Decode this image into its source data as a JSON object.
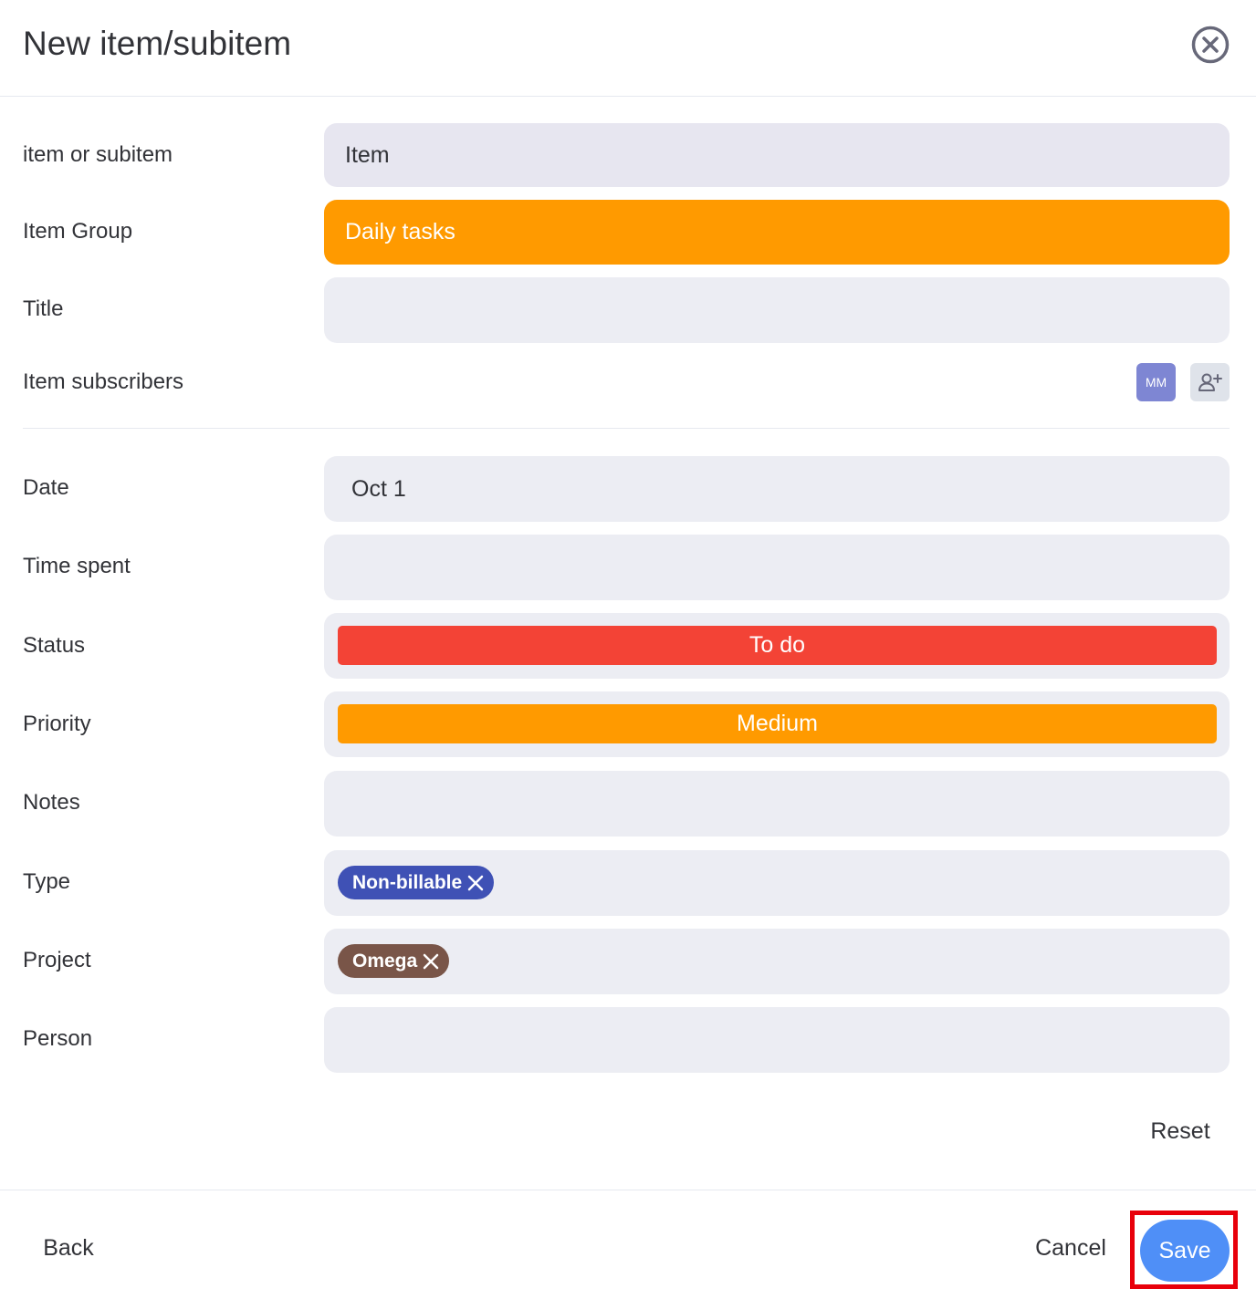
{
  "dialog": {
    "title": "New item/subitem"
  },
  "fields": {
    "kind": {
      "label": "item or subitem",
      "value": "Item"
    },
    "group": {
      "label": "Item Group",
      "value": "Daily tasks",
      "color": "#ff9a00"
    },
    "title": {
      "label": "Title",
      "value": ""
    },
    "subscribers": {
      "label": "Item subscribers",
      "avatar_initials": "MM",
      "avatar_color": "#7e86d3"
    },
    "date": {
      "label": "Date",
      "value": "Oct 1"
    },
    "time_spent": {
      "label": "Time spent",
      "value": ""
    },
    "status": {
      "label": "Status",
      "value": "To do",
      "color": "#f34336"
    },
    "priority": {
      "label": "Priority",
      "value": "Medium",
      "color": "#ff9a00"
    },
    "notes": {
      "label": "Notes",
      "value": ""
    },
    "type": {
      "label": "Type",
      "chip": "Non-billable",
      "chip_color": "#3f51b5"
    },
    "project": {
      "label": "Project",
      "chip": "Omega",
      "chip_color": "#795548"
    },
    "person": {
      "label": "Person",
      "value": ""
    }
  },
  "actions": {
    "reset_label": "Reset",
    "back_label": "Back",
    "cancel_label": "Cancel",
    "save_label": "Save",
    "save_color": "#4f8ff7",
    "highlight_color": "#e8000b"
  },
  "icons": {
    "close": "close-circle-icon",
    "add_subscriber": "person-add-icon",
    "chip_remove": "x-icon"
  }
}
